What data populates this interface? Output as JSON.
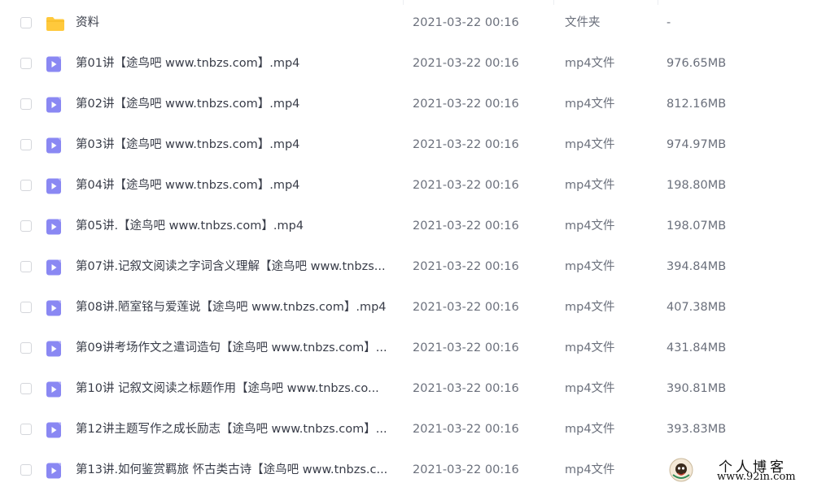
{
  "files": [
    {
      "kind": "folder",
      "icon": "folder-icon",
      "name": "资料",
      "modified": "2021-03-22 00:16",
      "type": "文件夹",
      "size": "-"
    },
    {
      "kind": "video",
      "icon": "video-file-icon",
      "name": "第01讲【途鸟吧 www.tnbzs.com】.mp4",
      "modified": "2021-03-22 00:16",
      "type": "mp4文件",
      "size": "976.65MB"
    },
    {
      "kind": "video",
      "icon": "video-file-icon",
      "name": "第02讲【途鸟吧 www.tnbzs.com】.mp4",
      "modified": "2021-03-22 00:16",
      "type": "mp4文件",
      "size": "812.16MB"
    },
    {
      "kind": "video",
      "icon": "video-file-icon",
      "name": "第03讲【途鸟吧 www.tnbzs.com】.mp4",
      "modified": "2021-03-22 00:16",
      "type": "mp4文件",
      "size": "974.97MB"
    },
    {
      "kind": "video",
      "icon": "video-file-icon",
      "name": "第04讲【途鸟吧 www.tnbzs.com】.mp4",
      "modified": "2021-03-22 00:16",
      "type": "mp4文件",
      "size": "198.80MB"
    },
    {
      "kind": "video",
      "icon": "video-file-icon",
      "name": "第05讲.【途鸟吧 www.tnbzs.com】.mp4",
      "modified": "2021-03-22 00:16",
      "type": "mp4文件",
      "size": "198.07MB"
    },
    {
      "kind": "video",
      "icon": "video-file-icon",
      "name": "第07讲.记叙文阅读之字词含义理解【途鸟吧 www.tnbzs...",
      "modified": "2021-03-22 00:16",
      "type": "mp4文件",
      "size": "394.84MB"
    },
    {
      "kind": "video",
      "icon": "video-file-icon",
      "name": "第08讲.陋室铭与爱莲说【途鸟吧 www.tnbzs.com】.mp4",
      "modified": "2021-03-22 00:16",
      "type": "mp4文件",
      "size": "407.38MB"
    },
    {
      "kind": "video",
      "icon": "video-file-icon",
      "name": "第09讲考场作文之遣词造句【途鸟吧 www.tnbzs.com】...",
      "modified": "2021-03-22 00:16",
      "type": "mp4文件",
      "size": "431.84MB"
    },
    {
      "kind": "video",
      "icon": "video-file-icon",
      "name": "第10讲 记叙文阅读之标题作用【途鸟吧 www.tnbzs.co...",
      "modified": "2021-03-22 00:16",
      "type": "mp4文件",
      "size": "390.81MB"
    },
    {
      "kind": "video",
      "icon": "video-file-icon",
      "name": "第12讲主题写作之成长励志【途鸟吧 www.tnbzs.com】...",
      "modified": "2021-03-22 00:16",
      "type": "mp4文件",
      "size": "393.83MB"
    },
    {
      "kind": "video",
      "icon": "video-file-icon",
      "name": "第13讲.如何鉴赏羁旅 怀古类古诗【途鸟吧 www.tnbzs.c...",
      "modified": "2021-03-22 00:16",
      "type": "mp4文件",
      "size": ""
    }
  ],
  "watermark": {
    "title": "个人博客",
    "url": "www.92in.com"
  },
  "colors": {
    "folder": "#ffc93c",
    "video": "#8a88f3",
    "checkbox_border": "#d4d6db"
  }
}
